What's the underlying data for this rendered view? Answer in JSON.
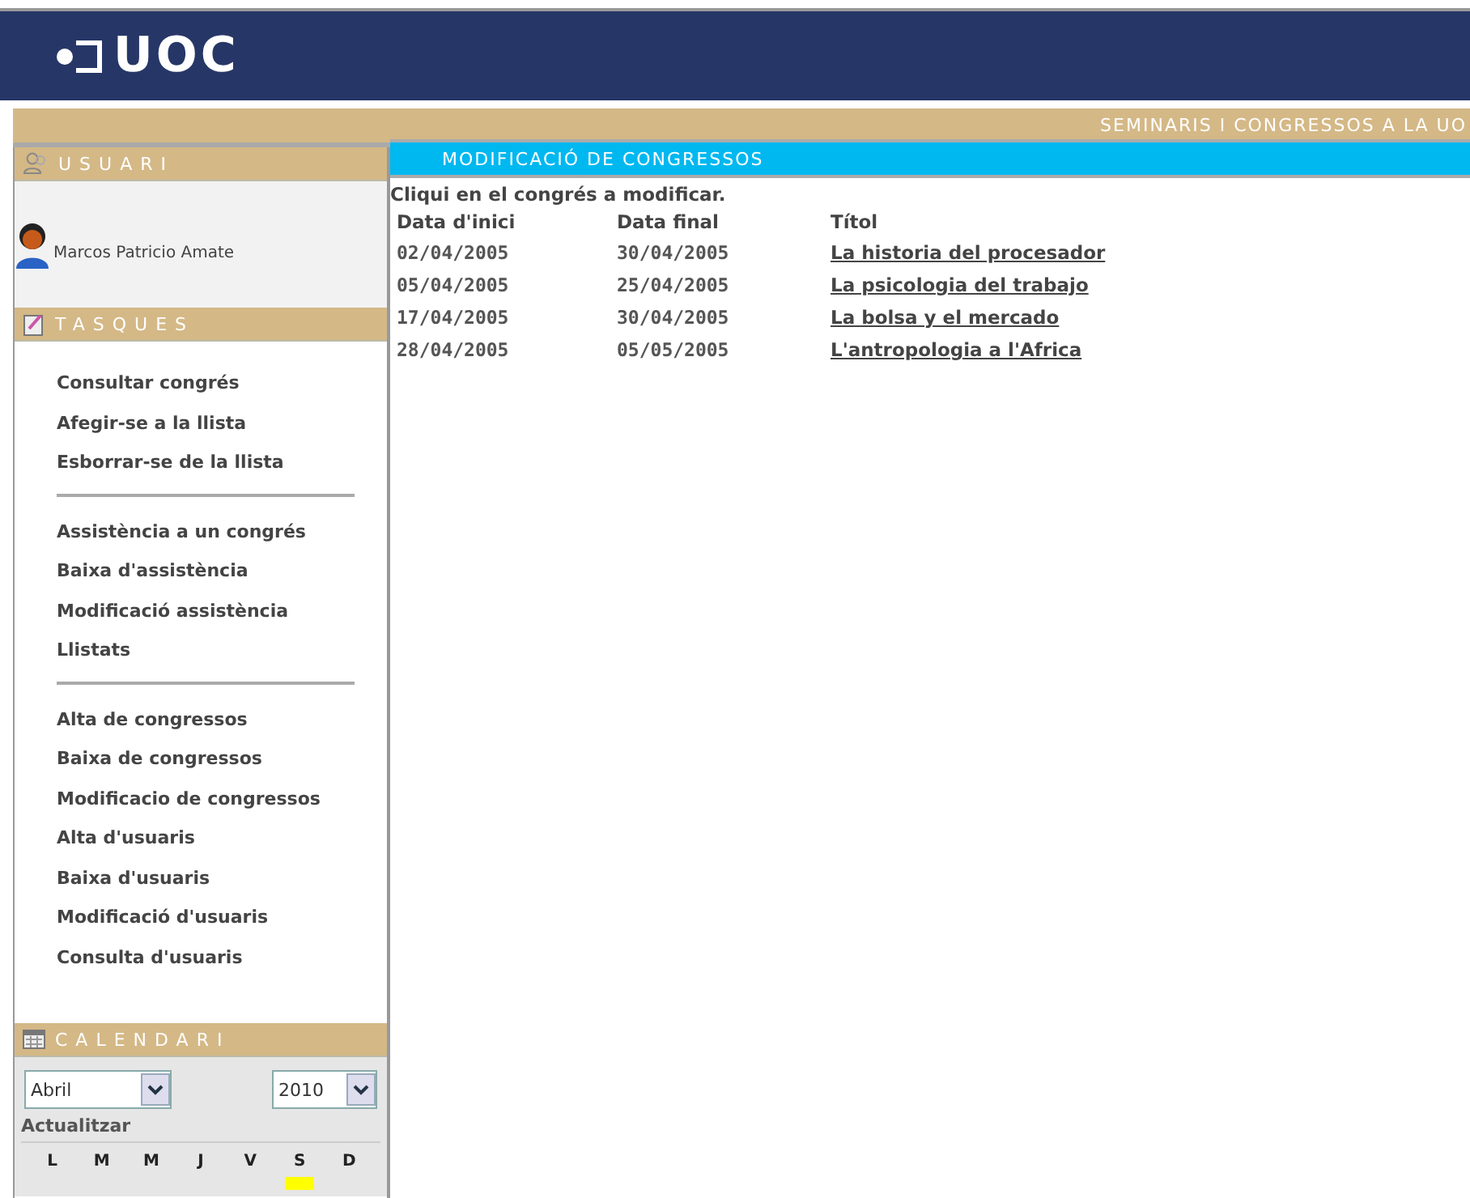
{
  "header": {
    "logo": "UOC"
  },
  "banner": {
    "title": "SEMINARIS I CONGRESSOS A LA UO"
  },
  "sidebar": {
    "user_section": {
      "title": "USUARI",
      "user_name": "Marcos Patricio Amate"
    },
    "tasks_section": {
      "title": "TASQUES",
      "groups": [
        {
          "items": [
            "Consultar congrés",
            "Afegir-se a la llista",
            "Esborrar-se de la llista"
          ]
        },
        {
          "items": [
            "Assistència a un congrés",
            "Baixa d'assistència",
            "Modificació assistència",
            "Llistats"
          ]
        },
        {
          "items": [
            "Alta de congressos",
            "Baixa de congressos",
            "Modificacio de congressos",
            "Alta d'usuaris",
            "Baixa d'usuaris",
            "Modificació d'usuaris",
            "Consulta d'usuaris"
          ]
        }
      ]
    },
    "calendar": {
      "title": "CALENDARI",
      "month": "Abril",
      "year": "2010",
      "update_label": "Actualitzar",
      "weekdays": [
        {
          "label": "L",
          "highlighted": false
        },
        {
          "label": "M",
          "highlighted": false
        },
        {
          "label": "M",
          "highlighted": false
        },
        {
          "label": "J",
          "highlighted": false
        },
        {
          "label": "V",
          "highlighted": false
        },
        {
          "label": "S",
          "highlighted": true
        },
        {
          "label": "D",
          "highlighted": false
        }
      ]
    }
  },
  "main": {
    "title": "MODIFICACIÓ DE CONGRESSOS",
    "instruction": "Cliqui en el congrés a modificar.",
    "table": {
      "columns": [
        "Data d'inici",
        "Data final",
        "Títol"
      ],
      "rows": [
        {
          "start": "02/04/2005",
          "end": "30/04/2005",
          "title": "La historia del procesador"
        },
        {
          "start": "05/04/2005",
          "end": "25/04/2005",
          "title": "La psicologia del trabajo"
        },
        {
          "start": "17/04/2005",
          "end": "30/04/2005",
          "title": "La bolsa y el mercado"
        },
        {
          "start": "28/04/2005",
          "end": "05/05/2005",
          "title": "L'antropologia a l'Africa"
        }
      ]
    }
  }
}
